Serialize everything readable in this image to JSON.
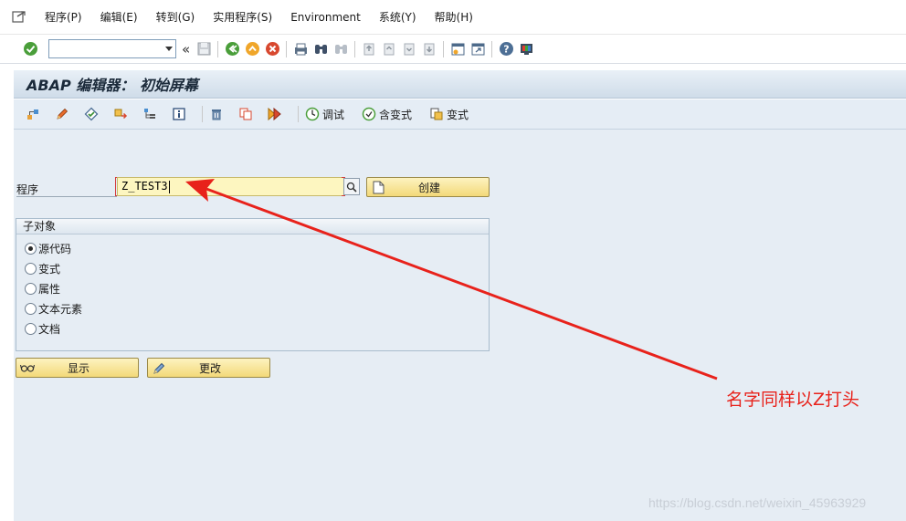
{
  "menu": {
    "items": [
      "程序(P)",
      "编辑(E)",
      "转到(G)",
      "实用程序(S)",
      "Environment",
      "系统(Y)",
      "帮助(H)"
    ]
  },
  "command_field": {
    "value": ""
  },
  "title": "ABAP 编辑器： 初始屏幕",
  "app_toolbar": {
    "debug_label": "调试",
    "with_variant_label": "含变式",
    "variant_label": "变式"
  },
  "program": {
    "label": "程序",
    "value": "Z_TEST3"
  },
  "buttons": {
    "create": "创建",
    "display": "显示",
    "change": "更改"
  },
  "subobjects": {
    "title": "子对象",
    "options": [
      {
        "label": "源代码",
        "selected": true
      },
      {
        "label": "变式",
        "selected": false
      },
      {
        "label": "属性",
        "selected": false
      },
      {
        "label": "文本元素",
        "selected": false
      },
      {
        "label": "文档",
        "selected": false
      }
    ]
  },
  "annotation": {
    "text": "名字同样以Z打头",
    "color": "#e8221b"
  },
  "watermark": "https://blog.csdn.net/weixin_45963929",
  "colors": {
    "button_gold": "#f3d979",
    "input_yellow": "#fdf6c0",
    "panel_blue": "#e6edf4"
  }
}
